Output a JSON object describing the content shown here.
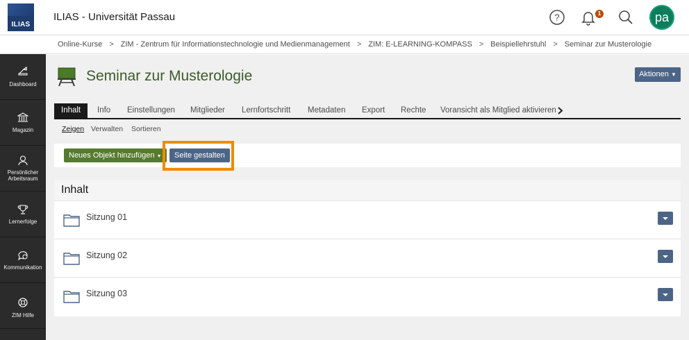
{
  "header": {
    "logo_text": "ILIAS",
    "app_title": "ILIAS - Universität Passau",
    "notification_count": "1",
    "avatar_initials": "pa",
    "icons": [
      "help-icon",
      "bell-icon",
      "search-icon"
    ]
  },
  "breadcrumb": [
    "Online-Kurse",
    "ZIM - Zentrum für Informationstechnologie und Medienmanagement",
    "ZIM: E-LEARNING-KOMPASS",
    "Beispiellehrstuhl",
    "Seminar zur Musterologie"
  ],
  "sidebar": {
    "items": [
      {
        "label": "Dashboard",
        "icon": "dashboard-icon"
      },
      {
        "label": "Magazin",
        "icon": "repository-icon"
      },
      {
        "label": "Persönlicher Arbeitsraum",
        "line1": "Persönlicher",
        "line2": "Arbeitsraum",
        "icon": "user-icon"
      },
      {
        "label": "Lernerfolge",
        "icon": "trophy-icon"
      },
      {
        "label": "Kommunikation",
        "icon": "chat-icon"
      },
      {
        "label": "ZIM Hilfe",
        "icon": "lifebuoy-icon"
      }
    ]
  },
  "page": {
    "title": "Seminar zur Musterologie",
    "actions_label": "Aktionen",
    "tabs": [
      "Inhalt",
      "Info",
      "Einstellungen",
      "Mitglieder",
      "Lernfortschritt",
      "Metadaten",
      "Export",
      "Rechte",
      "Voransicht als Mitglied aktivieren"
    ],
    "active_tab": "Inhalt",
    "subtabs": [
      "Zeigen",
      "Verwalten",
      "Sortieren"
    ],
    "active_subtab": "Zeigen"
  },
  "toolbar": {
    "new_object_label": "Neues Objekt hinzufügen",
    "design_page_label": "Seite gestalten",
    "highlight_color": "#f08a00"
  },
  "content": {
    "heading": "Inhalt",
    "items": [
      {
        "name": "Sitzung 01"
      },
      {
        "name": "Sitzung 02"
      },
      {
        "name": "Sitzung 03"
      }
    ]
  },
  "colors": {
    "primary_button": "#4c6586",
    "new_button": "#557b2e",
    "sidebar_bg": "#2b2b2b",
    "title_color": "#3c5a2a"
  }
}
